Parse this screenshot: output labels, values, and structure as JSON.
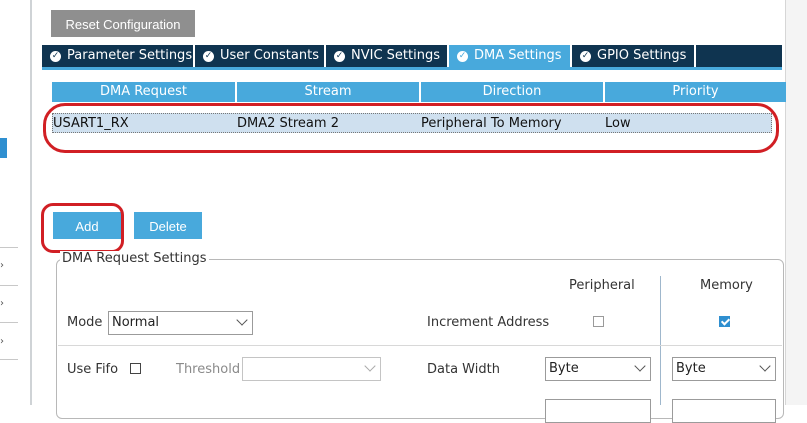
{
  "toolbar": {
    "reset_label": "Reset Configuration"
  },
  "tabs": [
    {
      "label": "Parameter Settings",
      "active": false
    },
    {
      "label": "User Constants",
      "active": false
    },
    {
      "label": "NVIC Settings",
      "active": false
    },
    {
      "label": "DMA Settings",
      "active": true
    },
    {
      "label": "GPIO Settings",
      "active": false
    }
  ],
  "dma_table": {
    "columns": [
      "DMA Request",
      "Stream",
      "Direction",
      "Priority"
    ],
    "rows": [
      {
        "request": "USART1_RX",
        "stream": "DMA2 Stream 2",
        "direction": "Peripheral To Memory",
        "priority": "Low"
      }
    ]
  },
  "actions": {
    "add_label": "Add",
    "delete_label": "Delete"
  },
  "settings": {
    "group_title": "DMA Request Settings",
    "mode_label": "Mode",
    "mode_value": "Normal",
    "use_fifo_label": "Use Fifo",
    "use_fifo_checked": false,
    "threshold_label": "Threshold",
    "threshold_value": "",
    "peripheral_header": "Peripheral",
    "memory_header": "Memory",
    "increment_label": "Increment Address",
    "peripheral_increment": false,
    "memory_increment": true,
    "data_width_label": "Data Width",
    "peripheral_width": "Byte",
    "memory_width": "Byte"
  },
  "colors": {
    "accent": "#48a9dc",
    "tab_dark": "#0f3450",
    "highlight": "#d11f24"
  }
}
